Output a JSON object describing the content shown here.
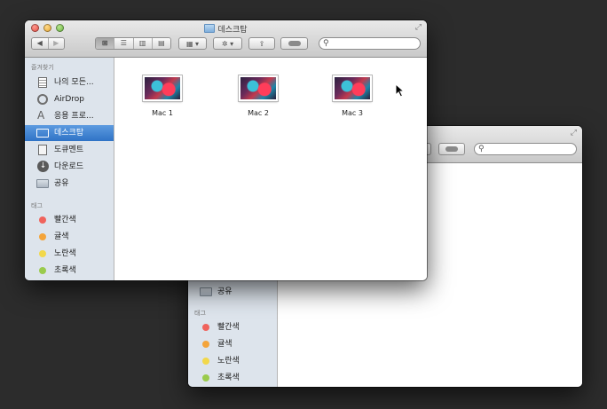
{
  "front_window": {
    "title": "데스크탑",
    "sidebar": {
      "favorites_header": "즐겨찾기",
      "items": [
        {
          "label": "나의 모든...",
          "icon": "all-files-icon"
        },
        {
          "label": "AirDrop",
          "icon": "airdrop-icon"
        },
        {
          "label": "응용 프로...",
          "icon": "applications-icon"
        },
        {
          "label": "데스크탑",
          "icon": "desktop-icon",
          "selected": true
        },
        {
          "label": "도큐멘트",
          "icon": "documents-icon"
        },
        {
          "label": "다운로드",
          "icon": "downloads-icon"
        },
        {
          "label": "공유",
          "icon": "shared-folder-icon"
        }
      ],
      "tags_header": "태그",
      "tags": [
        {
          "label": "빨간색",
          "color": "#f0635c"
        },
        {
          "label": "귤색",
          "color": "#f4a43a"
        },
        {
          "label": "노란색",
          "color": "#f2d84b"
        },
        {
          "label": "초록색",
          "color": "#9acb4c"
        }
      ]
    },
    "files": [
      {
        "name": "Mac 1"
      },
      {
        "name": "Mac 2"
      },
      {
        "name": "Mac 3"
      }
    ]
  },
  "back_window": {
    "sidebar": {
      "items": [
        {
          "label": "공유",
          "icon": "shared-folder-icon"
        }
      ],
      "tags_header": "태그",
      "tags": [
        {
          "label": "빨간색",
          "color": "#f0635c"
        },
        {
          "label": "귤색",
          "color": "#f4a43a"
        },
        {
          "label": "노란색",
          "color": "#f2d84b"
        },
        {
          "label": "초록색",
          "color": "#9acb4c"
        }
      ]
    }
  },
  "accent": "#3a7fd0"
}
